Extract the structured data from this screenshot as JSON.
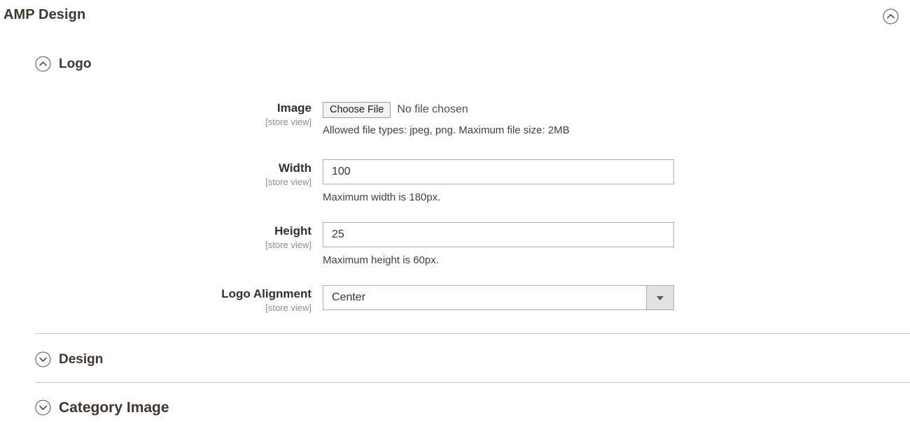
{
  "header": {
    "title": "AMP Design",
    "collapse_icon": "chevron-up-circle-icon"
  },
  "sections": [
    {
      "id": "logo",
      "label": "Logo",
      "state": "expanded",
      "icon": "chevron-up-circle-icon"
    },
    {
      "id": "design",
      "label": "Design",
      "state": "collapsed",
      "icon": "chevron-down-circle-icon"
    },
    {
      "id": "category_image",
      "label": "Category Image",
      "state": "collapsed",
      "icon": "chevron-down-circle-icon"
    }
  ],
  "logo_fields": {
    "image": {
      "label": "Image",
      "scope": "[store view]",
      "button_label": "Choose File",
      "file_status": "No file chosen",
      "note": "Allowed file types: jpeg, png. Maximum file size: 2MB"
    },
    "width": {
      "label": "Width",
      "scope": "[store view]",
      "value": "100",
      "note": "Maximum width is 180px."
    },
    "height": {
      "label": "Height",
      "scope": "[store view]",
      "value": "25",
      "note": "Maximum height is 60px."
    },
    "logo_alignment": {
      "label": "Logo Alignment",
      "scope": "[store view]",
      "selected": "Center",
      "arrow_icon": "triangle-down-icon"
    }
  },
  "colors": {
    "text": "#303030",
    "heading": "#41362f",
    "scope_text": "#8d8d8d",
    "border": "#adadad",
    "divider": "#c8c8c8",
    "select_button": "#e2e2e2"
  }
}
